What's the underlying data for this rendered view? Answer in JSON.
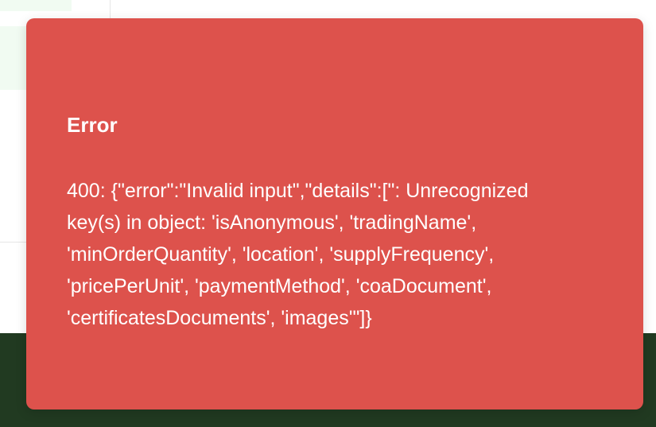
{
  "toast": {
    "title": "Error",
    "message": "400: {\"error\":\"Invalid input\",\"details\":[\": Unrecognized key(s) in object: 'isAnonymous', 'tradingName', 'minOrderQuantity', 'location', 'supplyFrequency', 'pricePerUnit', 'paymentMethod', 'coaDocument', 'certificatesDocuments', 'images'\"]}",
    "background_color": "#dd524c"
  },
  "background": {
    "footer_color": "#213a21",
    "highlight_color": "#f1fbf2"
  }
}
